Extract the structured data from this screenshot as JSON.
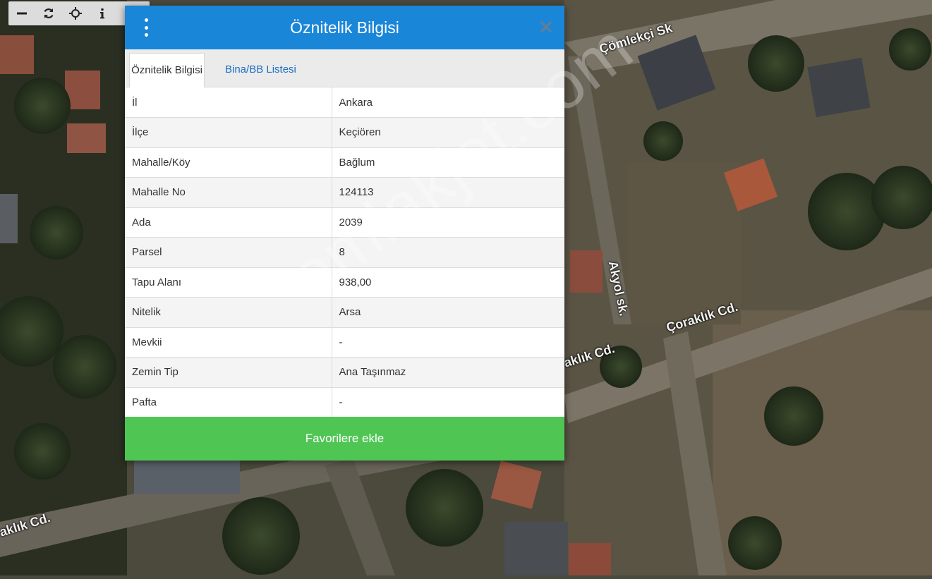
{
  "toolbar": {
    "buttons": [
      {
        "icon": "zoom-out-icon"
      },
      {
        "icon": "refresh-icon"
      },
      {
        "icon": "locate-icon"
      },
      {
        "icon": "info-icon"
      }
    ]
  },
  "map": {
    "roads": [
      "Çömlekçi Sk",
      "Akyol sk.",
      "Çoraklık Cd.",
      "aklık Cd.",
      "aklık Cd."
    ]
  },
  "watermark": "emlakjet.com",
  "dialog": {
    "title": "Öznitelik Bilgisi",
    "menu_icon": "vertical-dots-icon",
    "close_icon": "close-icon",
    "tabs": [
      "Öznitelik Bilgisi",
      "Bina/BB Listesi"
    ],
    "rows": [
      {
        "label": "İl",
        "value": "Ankara"
      },
      {
        "label": "İlçe",
        "value": "Keçiören"
      },
      {
        "label": "Mahalle/Köy",
        "value": "Bağlum"
      },
      {
        "label": "Mahalle No",
        "value": "124113"
      },
      {
        "label": "Ada",
        "value": "2039"
      },
      {
        "label": "Parsel",
        "value": "8"
      },
      {
        "label": "Tapu Alanı",
        "value": "938,00"
      },
      {
        "label": "Nitelik",
        "value": "Arsa"
      },
      {
        "label": "Mevkii",
        "value": "-"
      },
      {
        "label": "Zemin Tip",
        "value": "Ana Taşınmaz"
      },
      {
        "label": "Pafta",
        "value": "-"
      }
    ],
    "favorite_label": "Favorilere ekle"
  },
  "colors": {
    "header": "#1a86d8",
    "tab_link": "#1a6fc0",
    "favorite": "#4fc654"
  }
}
